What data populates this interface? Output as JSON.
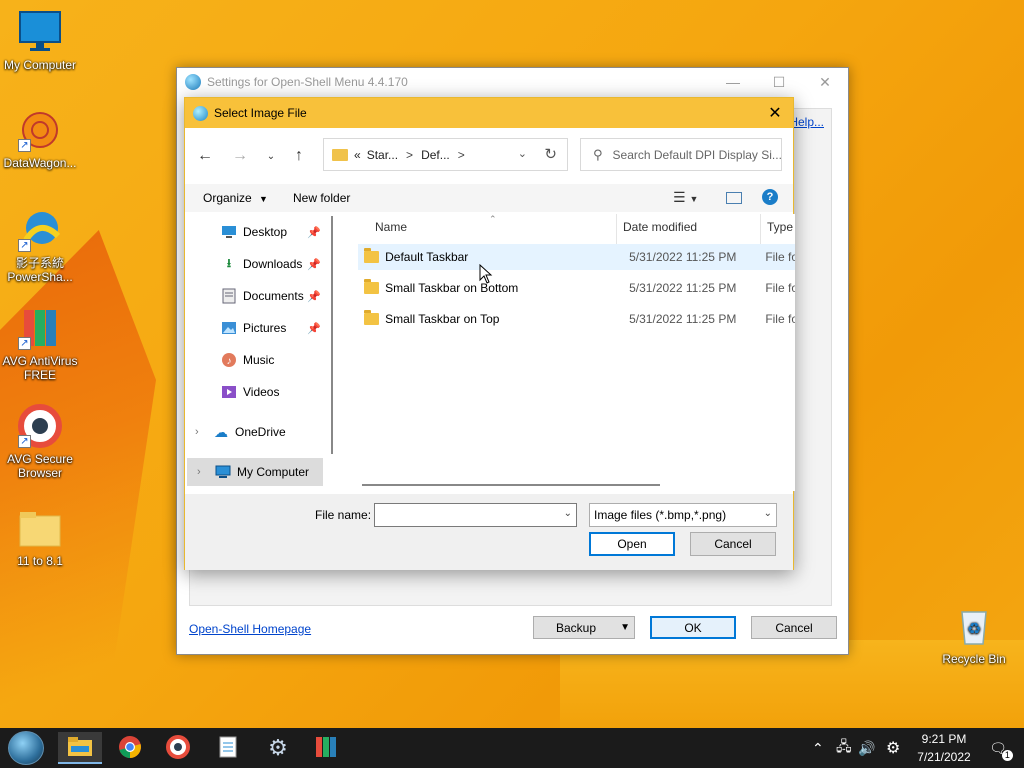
{
  "desktop": {
    "icons": [
      {
        "label": "My Computer",
        "icon": "monitor-icon"
      },
      {
        "label": "DataWagon...",
        "icon": "datawagon-icon"
      },
      {
        "label": "影子系統 PowerSha...",
        "icon": "powershadow-icon"
      },
      {
        "label": "AVG AntiVirus FREE",
        "icon": "avg-antivirus-icon"
      },
      {
        "label": "AVG Secure Browser",
        "icon": "avg-browser-icon"
      },
      {
        "label": "11 to 8.1",
        "icon": "folder-icon"
      },
      {
        "label": "Recycle Bin",
        "icon": "recycle-bin-icon"
      }
    ]
  },
  "settings_window": {
    "title": "Settings for Open-Shell Menu 4.4.170",
    "help_link": "Help...",
    "homepage_link": "Open-Shell Homepage",
    "backup_label": "Backup",
    "ok_label": "OK",
    "cancel_label": "Cancel"
  },
  "dialog": {
    "title": "Select Image File",
    "address": {
      "prefix": "«",
      "crumb1": "Star...",
      "crumb2": "Def...",
      "sep": ">"
    },
    "search_placeholder": "Search Default DPI Display Si...",
    "toolbar": {
      "organize": "Organize",
      "new_folder": "New folder"
    },
    "nav_items": [
      {
        "label": "Desktop",
        "icon": "desktop-icon",
        "pinned": true
      },
      {
        "label": "Downloads",
        "icon": "download-icon",
        "pinned": true
      },
      {
        "label": "Documents",
        "icon": "documents-icon",
        "pinned": true
      },
      {
        "label": "Pictures",
        "icon": "pictures-icon",
        "pinned": true
      },
      {
        "label": "Music",
        "icon": "music-icon",
        "pinned": false
      },
      {
        "label": "Videos",
        "icon": "videos-icon",
        "pinned": false
      },
      {
        "label": "OneDrive",
        "icon": "cloud-icon",
        "pinned": false
      },
      {
        "label": "My Computer",
        "icon": "computer-icon",
        "pinned": false,
        "selected": true
      }
    ],
    "columns": {
      "name": "Name",
      "date": "Date modified",
      "type": "Type"
    },
    "files": [
      {
        "name": "Default Taskbar",
        "date": "5/31/2022 11:25 PM",
        "type": "File fo"
      },
      {
        "name": "Small Taskbar on Bottom",
        "date": "5/31/2022 11:25 PM",
        "type": "File fo"
      },
      {
        "name": "Small Taskbar on Top",
        "date": "5/31/2022 11:25 PM",
        "type": "File fo"
      }
    ],
    "file_name_label": "File name:",
    "file_name_value": "",
    "file_type": "Image files (*.bmp,*.png)",
    "open_label": "Open",
    "cancel_label": "Cancel"
  },
  "taskbar": {
    "apps": [
      "file-explorer-icon",
      "chrome-icon",
      "avg-browser-icon",
      "notepad-icon",
      "settings-gear-icon",
      "avg-icon"
    ],
    "time": "9:21 PM",
    "date": "7/21/2022",
    "notification_count": "1"
  }
}
